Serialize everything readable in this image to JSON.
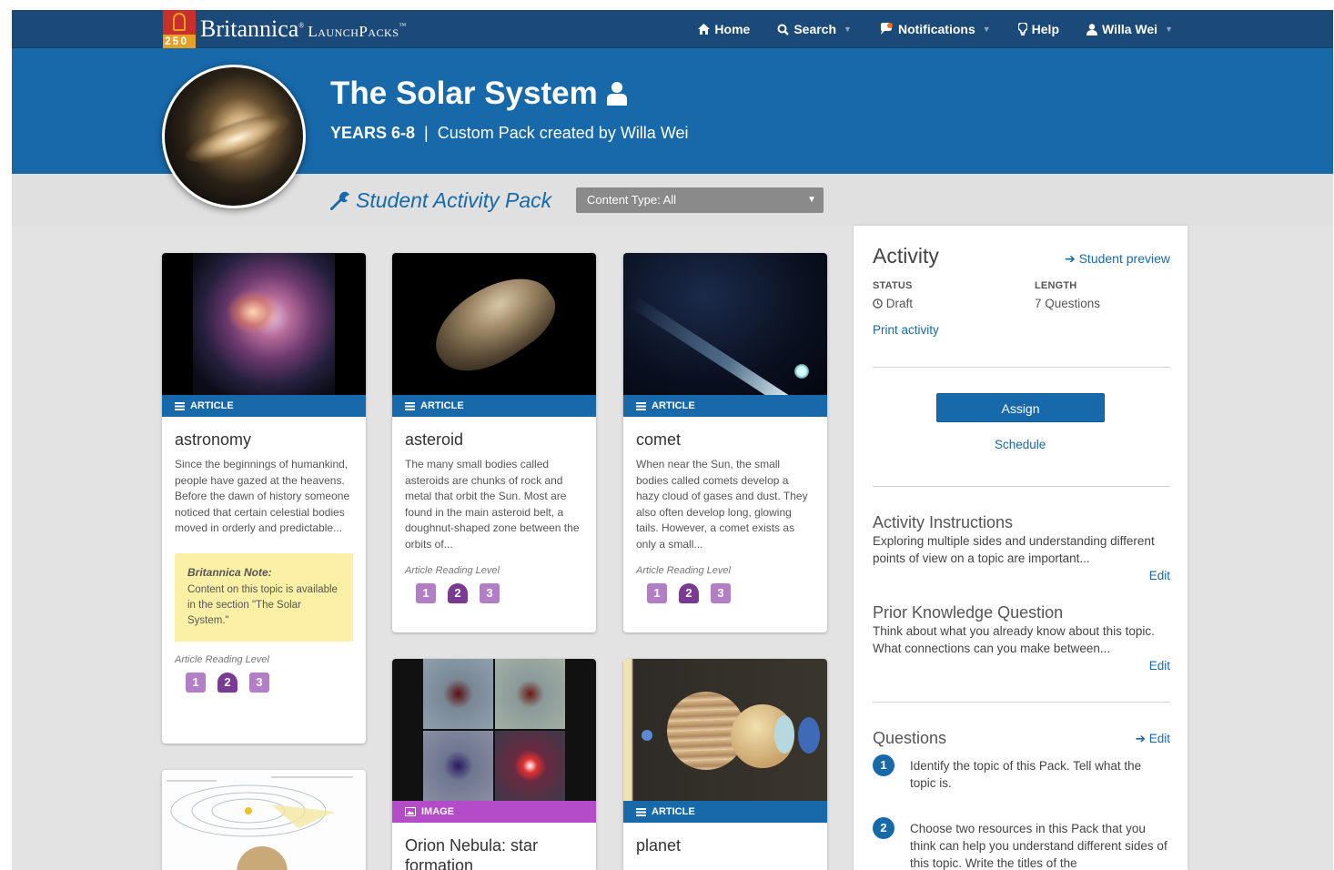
{
  "brand": {
    "badge_number": "250",
    "name": "Britannica",
    "product": "LaunchPacks"
  },
  "nav": [
    {
      "label": "Home",
      "icon": "home-icon"
    },
    {
      "label": "Search",
      "icon": "search-icon"
    },
    {
      "label": "Notifications",
      "icon": "chat-bubble-icon"
    },
    {
      "label": "Help",
      "icon": "lightbulb-icon"
    },
    {
      "label": "Willa Wei",
      "icon": "user-icon"
    }
  ],
  "hero": {
    "title": "The Solar System",
    "years": "YEARS 6-8",
    "separator": "|",
    "subtitle": "Custom Pack created by Willa Wei"
  },
  "subbar": {
    "pack_label": "Student Activity Pack",
    "content_type": "Content Type: All"
  },
  "cards": [
    {
      "type": "ARTICLE",
      "title": "astronomy",
      "desc": "Since the beginnings of humankind, people have gazed at the heavens. Before the dawn of history someone noticed that certain celestial bodies moved in orderly and predictable...",
      "note_title": "Britannica Note:",
      "note_body": "Content on this topic is available in the section \"The Solar System.\"",
      "reading_label": "Article Reading Level",
      "levels": [
        "1",
        "2",
        "3"
      ],
      "selected_level": "2"
    },
    {
      "type": "ARTICLE",
      "title": "asteroid",
      "desc": "The many small bodies called asteroids are chunks of rock and metal that orbit the Sun. Most are found in the main asteroid belt, a doughnut-shaped zone between the orbits of...",
      "reading_label": "Article Reading Level",
      "levels": [
        "1",
        "2",
        "3"
      ],
      "selected_level": "2"
    },
    {
      "type": "ARTICLE",
      "title": "comet",
      "desc": "When near the Sun, the small bodies called comets develop a hazy cloud of gases and dust. They also often develop long, glowing tails. However, a comet exists as only a small...",
      "reading_label": "Article Reading Level",
      "levels": [
        "1",
        "2",
        "3"
      ],
      "selected_level": "2"
    },
    {
      "type": "IMAGE",
      "title": "Orion Nebula: star formation"
    },
    {
      "type": "ARTICLE",
      "title": "planet"
    }
  ],
  "panel": {
    "title": "Activity",
    "student_preview": "Student preview",
    "status_label": "STATUS",
    "status_value": "Draft",
    "length_label": "LENGTH",
    "length_value": "7 Questions",
    "print": "Print activity",
    "assign": "Assign",
    "schedule": "Schedule",
    "instructions_title": "Activity Instructions",
    "instructions_text": "Exploring multiple sides and understanding different points of view on a topic are important...",
    "prior_title": "Prior Knowledge Question",
    "prior_text": "Think about what you already know about this topic. What connections can you make between...",
    "edit": "Edit",
    "questions_title": "Questions",
    "questions": [
      {
        "num": "1",
        "text": "Identify the topic of this Pack. Tell what the topic is."
      },
      {
        "num": "2",
        "text": "Choose two resources in this Pack that you think can help you understand different sides of this topic. Write the titles of the"
      }
    ]
  },
  "colors": {
    "nav_bg": "#1c4a78",
    "hero_bg": "#1769aa",
    "image_ribbon": "#b44bc8",
    "level_selected": "#7a3a94",
    "note_bg": "#fbf0a6"
  }
}
